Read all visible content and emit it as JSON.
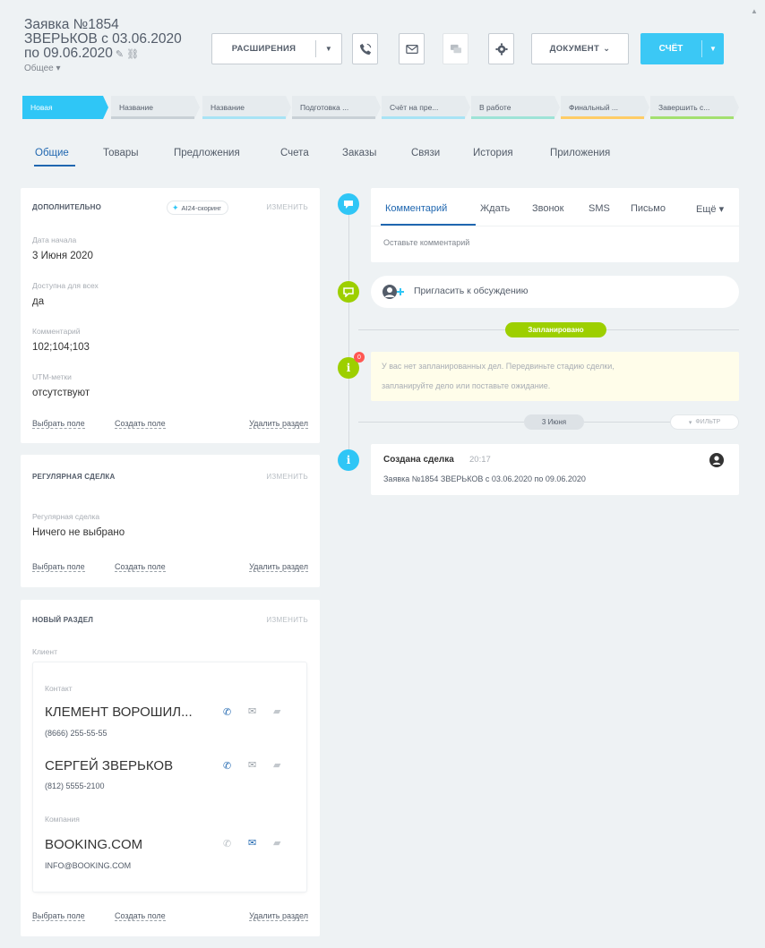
{
  "header": {
    "title_line1": "Заявка №1854",
    "title_line2": "ЗВЕРЬКОВ с 03.06.2020",
    "title_line3": "по  09.06.2020",
    "section": "Общее",
    "extensions_label": "РАСШИРЕНИЯ",
    "document_label": "ДОКУМЕНТ",
    "invoice_label": "СЧЁТ"
  },
  "stages": [
    {
      "label": "Новая",
      "color": "#2fc6f6"
    },
    {
      "label": "Название",
      "color": "#c8d0d6"
    },
    {
      "label": "Название",
      "color": "#a8e3f5"
    },
    {
      "label": "Подготовка ...",
      "color": "#c8d0d6"
    },
    {
      "label": "Счёт на пре...",
      "color": "#a8e3f5"
    },
    {
      "label": "В работе",
      "color": "#9ee3d7"
    },
    {
      "label": "Финальный ...",
      "color": "#ffcc66"
    },
    {
      "label": "Завершить с...",
      "color": "#a3e070"
    }
  ],
  "tabs": [
    "Общие",
    "Товары",
    "Предложения",
    "Счета",
    "Заказы",
    "Связи",
    "История",
    "Приложения"
  ],
  "panels": {
    "extra": {
      "title": "ДОПОЛНИТЕЛЬНО",
      "ai_badge": "AI24-скоринг",
      "edit": "ИЗМЕНИТЬ",
      "fields": [
        {
          "label": "Дата начала",
          "value": "3 Июня 2020"
        },
        {
          "label": "Доступна для всех",
          "value": "да"
        },
        {
          "label": "Комментарий",
          "value": "102;104;103"
        },
        {
          "label": "UTM-метки",
          "value": "отсутствуют"
        }
      ]
    },
    "regular": {
      "title": "РЕГУЛЯРНАЯ СДЕЛКА",
      "edit": "ИЗМЕНИТЬ",
      "field_label": "Регулярная сделка",
      "field_value": "Ничего не выбрано"
    },
    "newsection": {
      "title": "НОВЫЙ РАЗДЕЛ",
      "edit": "ИЗМЕНИТЬ",
      "client_label": "Клиент",
      "contact_label": "Контакт",
      "contacts": [
        {
          "name": "КЛЕМЕНТ ВОРОШИЛ...",
          "phone": "(8666) 255-55-55"
        },
        {
          "name": "СЕРГЕЙ ЗВЕРЬКОВ",
          "phone": "(812) 5555-2100"
        }
      ],
      "company_label": "Компания",
      "company": {
        "name": "BOOKING.COM",
        "email": "INFO@BOOKING.COM"
      }
    },
    "footer": {
      "select_field": "Выбрать поле",
      "create_field": "Создать поле",
      "delete_section": "Удалить раздел"
    }
  },
  "timeline": {
    "composer_tabs": [
      "Комментарий",
      "Ждать",
      "Звонок",
      "SMS",
      "Письмо",
      "Ещё"
    ],
    "composer_placeholder": "Оставьте комментарий",
    "invite": "Пригласить к обсуждению",
    "planned_label": "Запланировано",
    "notice_line1": "У вас нет запланированных дел. Передвиньте стадию сделки,",
    "notice_line2": "запланируйте дело или поставьте ожидание.",
    "notice_count": "0",
    "date_label": "3 Июня",
    "filter_label": "ФИЛЬТР",
    "deal_title": "Создана сделка",
    "deal_time": "20:17",
    "deal_text": "Заявка №1854 ЗВЕРЬКОВ с 03.06.2020 по 09.06.2020"
  },
  "colors": {
    "accent": "#2fc6f6",
    "link": "#2067b0",
    "green": "#9dcf00",
    "text": "#535c69",
    "background": "#eef2f4"
  }
}
